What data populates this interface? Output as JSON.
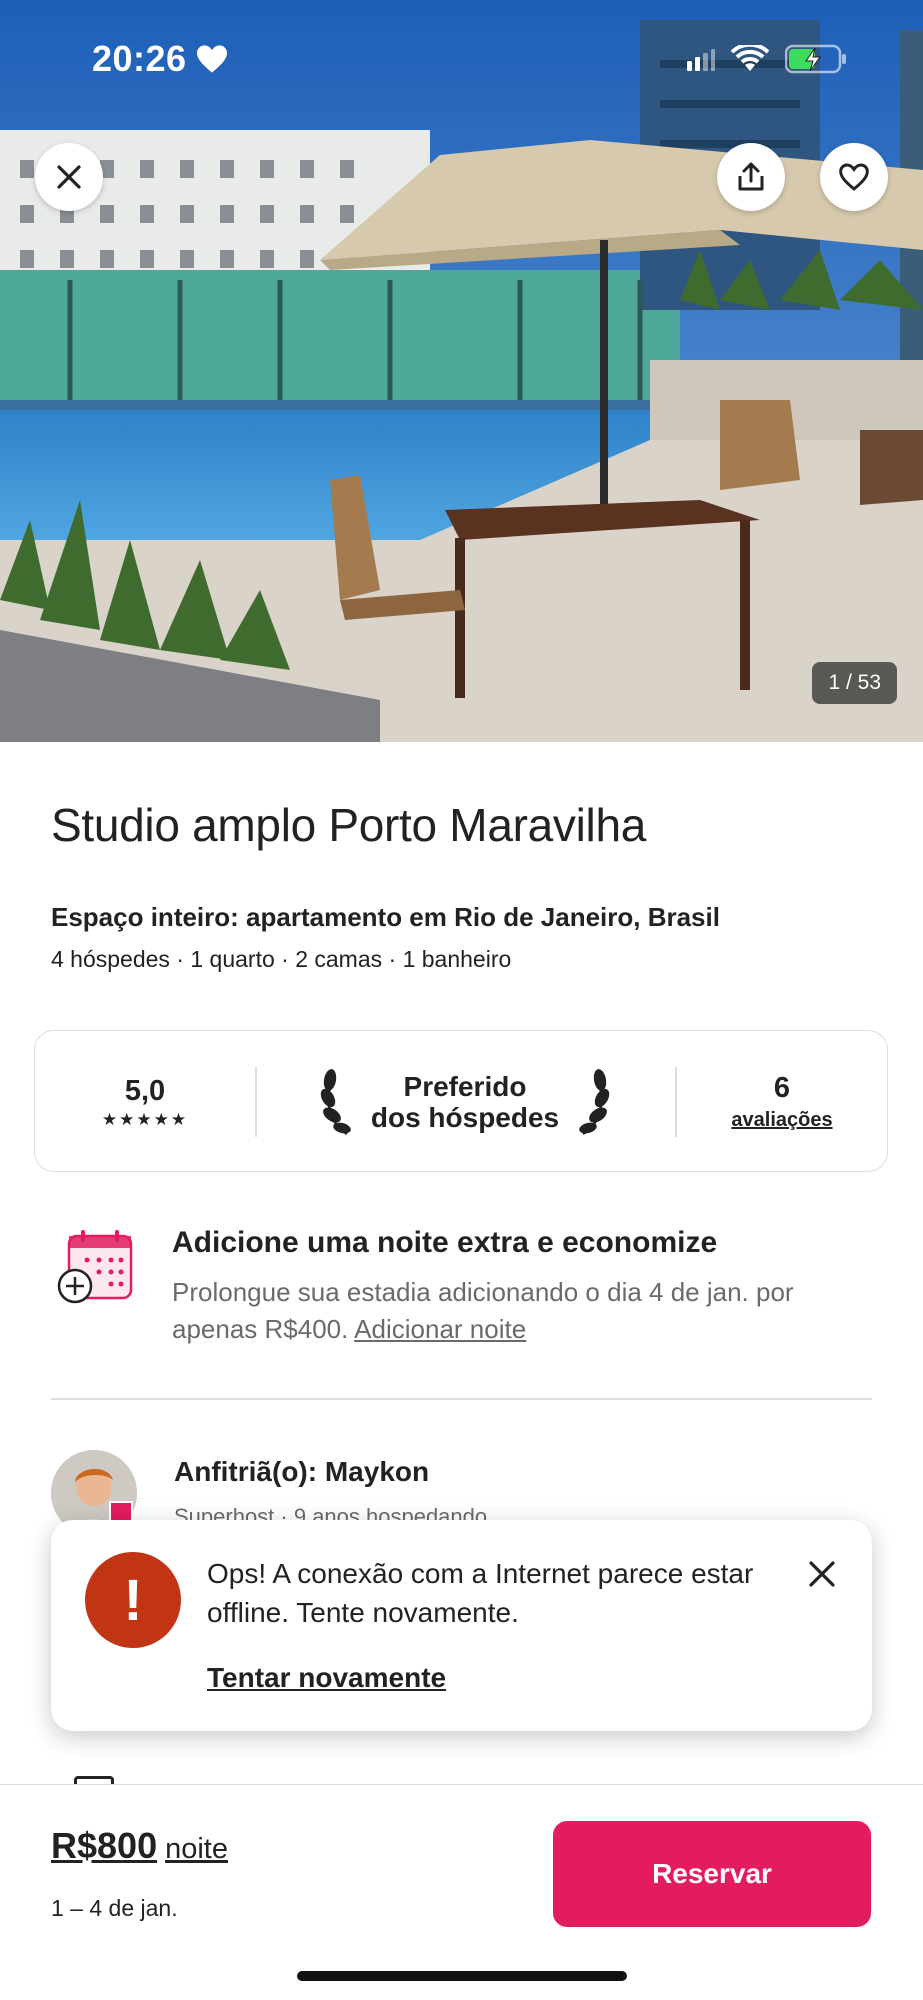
{
  "status_bar": {
    "time": "20:26"
  },
  "hero": {
    "photo_counter": "1 / 53"
  },
  "listing": {
    "title": "Studio amplo Porto Maravilha",
    "subtitle": "Espaço inteiro: apartamento em Rio de Janeiro, Brasil",
    "details": "4 hóspedes · 1 quarto · 2 camas · 1 banheiro"
  },
  "rating_card": {
    "score": "5,0",
    "stars": "★★★★★",
    "badge_line1": "Preferido",
    "badge_line2": "dos hóspedes",
    "reviews_count": "6",
    "reviews_label": "avaliações"
  },
  "promo": {
    "title": "Adicione uma noite extra e economize",
    "text": "Prolongue sua estadia adicionando o dia 4 de jan. por apenas R$400.",
    "link": "Adicionar noite"
  },
  "host": {
    "name": "Anfitriã(o): Maykon",
    "sub": "Superhost · 9 anos hospedando"
  },
  "toast": {
    "message": "Ops! A conexão com a Internet parece estar offline. Tente novamente.",
    "retry": "Tentar novamente"
  },
  "footer": {
    "price": "R$800",
    "unit": "noite",
    "dates": "1 – 4 de jan.",
    "reserve": "Reservar"
  },
  "colors": {
    "brand": "#e31c5f",
    "error": "#c13515"
  }
}
